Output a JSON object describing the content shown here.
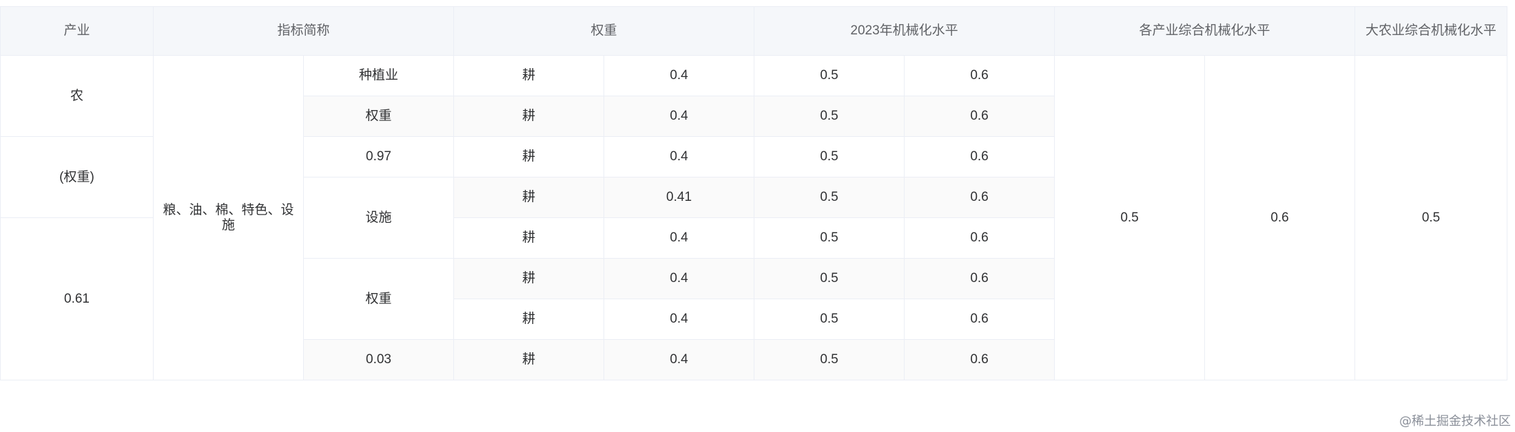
{
  "table": {
    "headers": {
      "industry": "产业",
      "indicator": "指标简称",
      "weight": "权重",
      "level_2023": "2023年机械化水平",
      "industry_level": "各产业综合机械化水平",
      "agri_level": "大农业综合机械化水平"
    },
    "col1": {
      "a": "农",
      "b": "(权重)",
      "c": "0.61"
    },
    "col2": {
      "value": "粮、油、棉、特色、设施"
    },
    "col3": {
      "a": "种植业",
      "b": "权重",
      "c": "0.97",
      "d": "设施",
      "e": "权重",
      "f": "0.03"
    },
    "rows": [
      {
        "op": "耕",
        "w": "0.4",
        "v1": "0.5",
        "v2": "0.6"
      },
      {
        "op": "耕",
        "w": "0.4",
        "v1": "0.5",
        "v2": "0.6"
      },
      {
        "op": "耕",
        "w": "0.4",
        "v1": "0.5",
        "v2": "0.6"
      },
      {
        "op": "耕",
        "w": "0.41",
        "v1": "0.5",
        "v2": "0.6"
      },
      {
        "op": "耕",
        "w": "0.4",
        "v1": "0.5",
        "v2": "0.6"
      },
      {
        "op": "耕",
        "w": "0.4",
        "v1": "0.5",
        "v2": "0.6"
      },
      {
        "op": "耕",
        "w": "0.4",
        "v1": "0.5",
        "v2": "0.6"
      },
      {
        "op": "耕",
        "w": "0.4",
        "v1": "0.5",
        "v2": "0.6"
      }
    ],
    "merged": {
      "x": "0.5",
      "y": "0.6",
      "z": "0.5"
    }
  },
  "watermark": "@稀土掘金技术社区"
}
